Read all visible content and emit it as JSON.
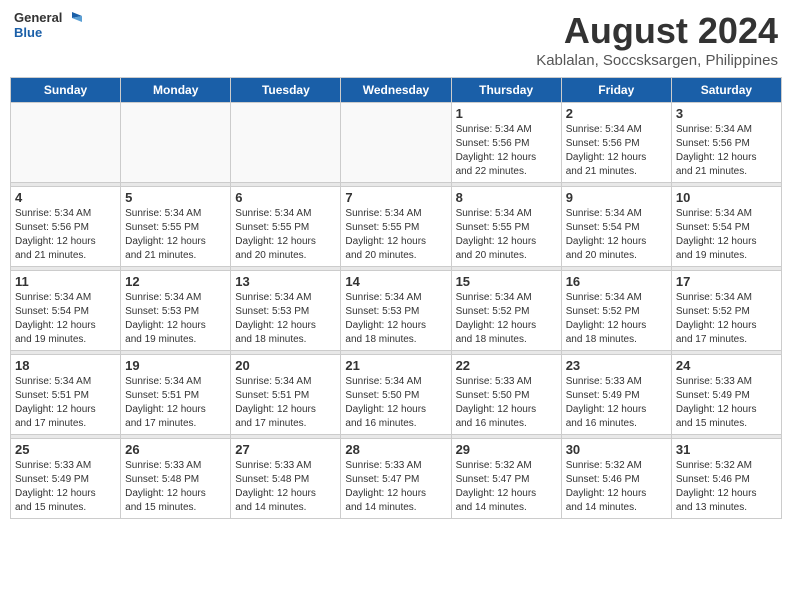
{
  "header": {
    "logo_general": "General",
    "logo_blue": "Blue",
    "month_year": "August 2024",
    "location": "Kablalan, Soccsksargen, Philippines"
  },
  "days_of_week": [
    "Sunday",
    "Monday",
    "Tuesday",
    "Wednesday",
    "Thursday",
    "Friday",
    "Saturday"
  ],
  "weeks": [
    [
      {
        "day": "",
        "info": ""
      },
      {
        "day": "",
        "info": ""
      },
      {
        "day": "",
        "info": ""
      },
      {
        "day": "",
        "info": ""
      },
      {
        "day": "1",
        "info": "Sunrise: 5:34 AM\nSunset: 5:56 PM\nDaylight: 12 hours\nand 22 minutes."
      },
      {
        "day": "2",
        "info": "Sunrise: 5:34 AM\nSunset: 5:56 PM\nDaylight: 12 hours\nand 21 minutes."
      },
      {
        "day": "3",
        "info": "Sunrise: 5:34 AM\nSunset: 5:56 PM\nDaylight: 12 hours\nand 21 minutes."
      }
    ],
    [
      {
        "day": "4",
        "info": "Sunrise: 5:34 AM\nSunset: 5:56 PM\nDaylight: 12 hours\nand 21 minutes."
      },
      {
        "day": "5",
        "info": "Sunrise: 5:34 AM\nSunset: 5:55 PM\nDaylight: 12 hours\nand 21 minutes."
      },
      {
        "day": "6",
        "info": "Sunrise: 5:34 AM\nSunset: 5:55 PM\nDaylight: 12 hours\nand 20 minutes."
      },
      {
        "day": "7",
        "info": "Sunrise: 5:34 AM\nSunset: 5:55 PM\nDaylight: 12 hours\nand 20 minutes."
      },
      {
        "day": "8",
        "info": "Sunrise: 5:34 AM\nSunset: 5:55 PM\nDaylight: 12 hours\nand 20 minutes."
      },
      {
        "day": "9",
        "info": "Sunrise: 5:34 AM\nSunset: 5:54 PM\nDaylight: 12 hours\nand 20 minutes."
      },
      {
        "day": "10",
        "info": "Sunrise: 5:34 AM\nSunset: 5:54 PM\nDaylight: 12 hours\nand 19 minutes."
      }
    ],
    [
      {
        "day": "11",
        "info": "Sunrise: 5:34 AM\nSunset: 5:54 PM\nDaylight: 12 hours\nand 19 minutes."
      },
      {
        "day": "12",
        "info": "Sunrise: 5:34 AM\nSunset: 5:53 PM\nDaylight: 12 hours\nand 19 minutes."
      },
      {
        "day": "13",
        "info": "Sunrise: 5:34 AM\nSunset: 5:53 PM\nDaylight: 12 hours\nand 18 minutes."
      },
      {
        "day": "14",
        "info": "Sunrise: 5:34 AM\nSunset: 5:53 PM\nDaylight: 12 hours\nand 18 minutes."
      },
      {
        "day": "15",
        "info": "Sunrise: 5:34 AM\nSunset: 5:52 PM\nDaylight: 12 hours\nand 18 minutes."
      },
      {
        "day": "16",
        "info": "Sunrise: 5:34 AM\nSunset: 5:52 PM\nDaylight: 12 hours\nand 18 minutes."
      },
      {
        "day": "17",
        "info": "Sunrise: 5:34 AM\nSunset: 5:52 PM\nDaylight: 12 hours\nand 17 minutes."
      }
    ],
    [
      {
        "day": "18",
        "info": "Sunrise: 5:34 AM\nSunset: 5:51 PM\nDaylight: 12 hours\nand 17 minutes."
      },
      {
        "day": "19",
        "info": "Sunrise: 5:34 AM\nSunset: 5:51 PM\nDaylight: 12 hours\nand 17 minutes."
      },
      {
        "day": "20",
        "info": "Sunrise: 5:34 AM\nSunset: 5:51 PM\nDaylight: 12 hours\nand 17 minutes."
      },
      {
        "day": "21",
        "info": "Sunrise: 5:34 AM\nSunset: 5:50 PM\nDaylight: 12 hours\nand 16 minutes."
      },
      {
        "day": "22",
        "info": "Sunrise: 5:33 AM\nSunset: 5:50 PM\nDaylight: 12 hours\nand 16 minutes."
      },
      {
        "day": "23",
        "info": "Sunrise: 5:33 AM\nSunset: 5:49 PM\nDaylight: 12 hours\nand 16 minutes."
      },
      {
        "day": "24",
        "info": "Sunrise: 5:33 AM\nSunset: 5:49 PM\nDaylight: 12 hours\nand 15 minutes."
      }
    ],
    [
      {
        "day": "25",
        "info": "Sunrise: 5:33 AM\nSunset: 5:49 PM\nDaylight: 12 hours\nand 15 minutes."
      },
      {
        "day": "26",
        "info": "Sunrise: 5:33 AM\nSunset: 5:48 PM\nDaylight: 12 hours\nand 15 minutes."
      },
      {
        "day": "27",
        "info": "Sunrise: 5:33 AM\nSunset: 5:48 PM\nDaylight: 12 hours\nand 14 minutes."
      },
      {
        "day": "28",
        "info": "Sunrise: 5:33 AM\nSunset: 5:47 PM\nDaylight: 12 hours\nand 14 minutes."
      },
      {
        "day": "29",
        "info": "Sunrise: 5:32 AM\nSunset: 5:47 PM\nDaylight: 12 hours\nand 14 minutes."
      },
      {
        "day": "30",
        "info": "Sunrise: 5:32 AM\nSunset: 5:46 PM\nDaylight: 12 hours\nand 14 minutes."
      },
      {
        "day": "31",
        "info": "Sunrise: 5:32 AM\nSunset: 5:46 PM\nDaylight: 12 hours\nand 13 minutes."
      }
    ]
  ]
}
